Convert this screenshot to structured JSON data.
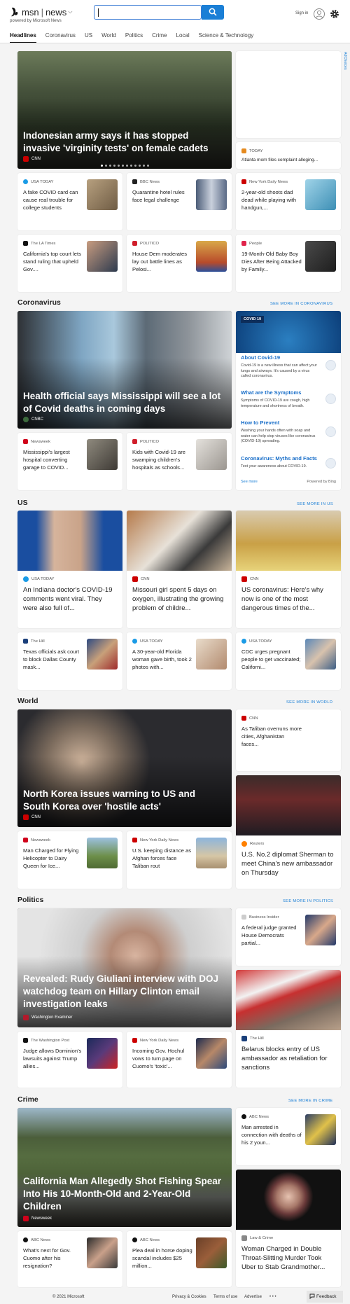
{
  "header": {
    "brand": "msn",
    "section": "news",
    "powered": "powered by Microsoft News",
    "sign_in": "Sign in"
  },
  "nav": [
    "Headlines",
    "Coronavirus",
    "US",
    "World",
    "Politics",
    "Crime",
    "Local",
    "Science & Technology"
  ],
  "top": {
    "hero": {
      "title": "Indonesian army says it has stopped invasive 'virginity tests' on female cadets",
      "source": "CNN"
    },
    "side": {
      "source": "TODAY",
      "title": "Atlanta mom files complaint alleging..."
    },
    "row1": [
      {
        "source": "USA TODAY",
        "title": "A fake COVID card can cause real trouble for college students"
      },
      {
        "source": "BBC News",
        "title": "Quarantine hotel rules face legal challenge"
      },
      {
        "source": "New York Daily News",
        "title": "2-year-old shoots dad dead while playing with handgun,..."
      }
    ],
    "row2": [
      {
        "source": "The LA Times",
        "title": "California's top court lets stand ruling that upheld Gov...."
      },
      {
        "source": "POLITICO",
        "title": "House Dem moderates lay out battle lines as Pelosi..."
      },
      {
        "source": "People",
        "title": "19-Month-Old Baby Boy Dies After Being Attacked by Family..."
      }
    ]
  },
  "ad_label": "AdChoices",
  "corona": {
    "heading": "Coronavirus",
    "see_more": "SEE MORE IN CORONAVIRUS",
    "hero": {
      "title": "Health official says Mississippi will see a lot of Covid deaths in coming days",
      "source": "CNBC"
    },
    "panel": {
      "tag": "COVID 19",
      "items": [
        {
          "h": "About Covid-19",
          "d": "Covid-19 is a new illness that can affect your lungs and airways. It's caused by a virus called coronavirus."
        },
        {
          "h": "What are the Symptoms",
          "d": "Symptoms of COVID-19 are cough, high temperature and shortness of breath."
        },
        {
          "h": "How to Prevent",
          "d": "Washing your hands often with soap and water can help stop viruses like coronavirus (COVID-19) spreading."
        },
        {
          "h": "Coronavirus: Myths and Facts",
          "d": "Test your awareness about COVID-19."
        }
      ],
      "see_more": "See more",
      "powered": "Powered by Bing"
    },
    "row": [
      {
        "source": "Newsweek",
        "title": "Mississippi's largest hospital converting garage to COVID..."
      },
      {
        "source": "POLITICO",
        "title": "Kids with Covid-19 are swamping children's hospitals as schools..."
      }
    ]
  },
  "us": {
    "heading": "US",
    "see_more": "SEE MORE IN US",
    "main": [
      {
        "source": "USA TODAY",
        "title": "An Indiana doctor's COVID-19 comments went viral. They were also full of..."
      },
      {
        "source": "CNN",
        "title": "Missouri girl spent 5 days on oxygen, illustrating the growing problem of childre..."
      },
      {
        "source": "CNN",
        "title": "US coronavirus: Here's why now is one of the most dangerous times of the..."
      }
    ],
    "row": [
      {
        "source": "The Hill",
        "title": "Texas officials ask court to block Dallas County mask..."
      },
      {
        "source": "USA TODAY",
        "title": "A 30-year-old Florida woman gave birth, took 2 photos with..."
      },
      {
        "source": "USA TODAY",
        "title": "CDC urges pregnant people to get vaccinated; Californi..."
      }
    ]
  },
  "world": {
    "heading": "World",
    "see_more": "SEE MORE IN WORLD",
    "hero": {
      "title": "North Korea issues warning to US and South Korea over 'hostile acts'",
      "source": "CNN"
    },
    "side": {
      "source": "CNN",
      "title": "As Taliban overruns more cities, Afghanistan faces..."
    },
    "side_big": {
      "source": "Reuters",
      "title": "U.S. No.2 diplomat Sherman to meet China's new ambassador on Thursday"
    },
    "row": [
      {
        "source": "Newsweek",
        "title": "Man Charged for Flying Helicopter to Dairy Queen for Ice..."
      },
      {
        "source": "New York Daily News",
        "title": "U.S. keeping distance as Afghan forces face Taliban rout"
      }
    ]
  },
  "politics": {
    "heading": "Politics",
    "see_more": "SEE MORE IN POLITICS",
    "hero": {
      "title": "Revealed: Rudy Giuliani interview with DOJ watchdog team on Hillary Clinton email investigation leaks",
      "source": "Washington Examiner"
    },
    "side": {
      "source": "Business Insider",
      "title": "A federal judge granted House Democrats partial..."
    },
    "side_big": {
      "source": "The Hill",
      "title": "Belarus blocks entry of US ambassador as retaliation for sanctions"
    },
    "row": [
      {
        "source": "The Washington Post",
        "title": "Judge allows Dominion's lawsuits against Trump allies..."
      },
      {
        "source": "New York Daily News",
        "title": "Incoming Gov. Hochul vows to turn page on Cuomo's 'toxic'..."
      }
    ]
  },
  "crime": {
    "heading": "Crime",
    "see_more": "SEE MORE IN CRIME",
    "hero": {
      "title": "California Man Allegedly Shot Fishing Spear Into His 10-Month-Old and 2-Year-Old Children",
      "source": "Newsweek"
    },
    "side": {
      "source": "ABC News",
      "title": "Man arrested in connection with deaths of his 2 youn..."
    },
    "side_big": {
      "source": "Law & Crime",
      "title": "Woman Charged in Double Throat-Slitting Murder Took Uber to Stab Grandmother..."
    },
    "row": [
      {
        "source": "ABC News",
        "title": "What's next for Gov. Cuomo after his resignation?"
      },
      {
        "source": "ABC News",
        "title": "Plea deal in horse doping scandal includes $25 million..."
      }
    ]
  },
  "footer": {
    "copyright": "© 2021 Microsoft",
    "privacy": "Privacy & Cookies",
    "terms": "Terms of use",
    "advertise": "Advertise",
    "more": "• • •",
    "feedback": "Feedback"
  },
  "colors": {
    "accent": "#1a7fd6",
    "cnn": "#cc0000",
    "politico": "#d01e2b",
    "usatoday": "#1a9be6"
  }
}
